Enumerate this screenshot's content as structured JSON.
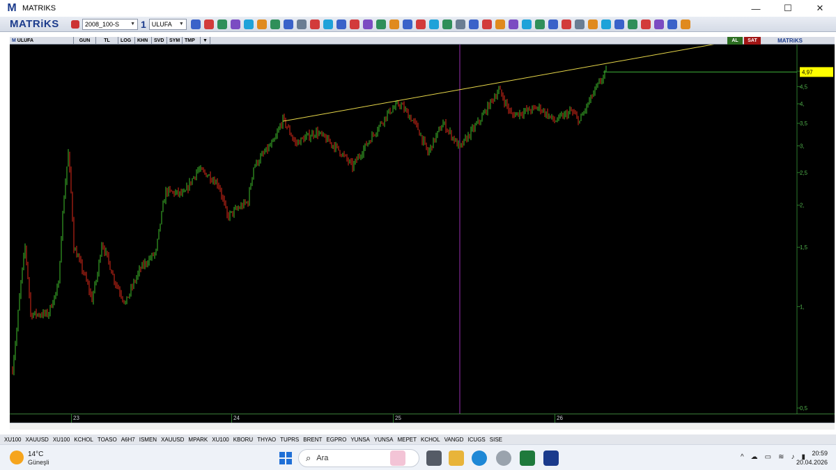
{
  "window": {
    "title": "MATRIKS",
    "controls": [
      "—",
      "☐",
      "✕"
    ]
  },
  "toolbar": {
    "brand": "MATRiKS",
    "template": "2008_100-S",
    "period": "1",
    "symbol": "ULUFA"
  },
  "chart_header": {
    "symbol": "ULUFA",
    "buttons": [
      "GUN",
      "TL",
      "LOG",
      "KHN",
      "SVD",
      "SYM",
      "TMP"
    ],
    "buy": "AL",
    "sell": "SAT",
    "brand": "MATRiKS"
  },
  "chart_data": {
    "type": "candlestick",
    "price_label": "4,97",
    "y_ticks": [
      "5,",
      "4,5",
      "4,",
      "3,5",
      "3,",
      "2,5",
      "2,",
      "1,5",
      "1,",
      "0,5"
    ],
    "x_labels": [
      "23",
      "24",
      "25",
      "26"
    ],
    "log_scale": true,
    "colors": {
      "up": "#3fbf2c",
      "down": "#e02a1a",
      "trendline": "#e8d84a",
      "price_line": "#3fb43a",
      "price_tag": "#ffff00",
      "marker": "#9b2fb5",
      "background": "#000000",
      "axis_text": "#4fae4a"
    }
  },
  "watchlist_tabs": [
    "XU100",
    "XAUUSD",
    "XU100",
    "KCHOL",
    "TOASO",
    "A6H7",
    "ISMEN",
    "XAUUSD",
    "MPARK",
    "XU100",
    "KBORU",
    "THYAO",
    "TUPRS",
    "BRENT",
    "EGPRO",
    "YUNSA",
    "YUNSA",
    "MEPET",
    "KCHOL",
    "VANGD",
    "ICUGS",
    "SISE"
  ],
  "taskbar": {
    "temperature": "14°C",
    "weather": "Güneşli",
    "search_placeholder": "Ara",
    "time": "20:59",
    "date": "20.04.2026"
  }
}
